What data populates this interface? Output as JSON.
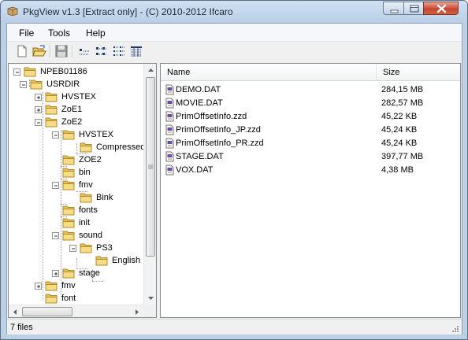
{
  "window": {
    "title": "PkgView v1.3 [Extract only] - (C) 2010-2012 Ifcaro"
  },
  "menu": [
    "File",
    "Tools",
    "Help"
  ],
  "toolbar": {
    "buttons": [
      "new-icon",
      "open-folder-icon",
      "save-icon",
      "large-icons-view-icon",
      "small-icons-view-icon",
      "list-view-icon",
      "details-view-icon"
    ]
  },
  "tree": {
    "nodes": [
      {
        "label": "NPEB01186"
      },
      {
        "label": "USRDIR"
      },
      {
        "label": "HVSTEX"
      },
      {
        "label": "ZoE1"
      },
      {
        "label": "ZoE2"
      },
      {
        "label": "HVSTEX"
      },
      {
        "label": "Compressed"
      },
      {
        "label": "ZOE2"
      },
      {
        "label": "bin"
      },
      {
        "label": "fmv"
      },
      {
        "label": "Bink"
      },
      {
        "label": "fonts"
      },
      {
        "label": "init"
      },
      {
        "label": "sound"
      },
      {
        "label": "PS3"
      },
      {
        "label": "English"
      },
      {
        "label": "stage"
      },
      {
        "label": "fmv"
      },
      {
        "label": "font"
      }
    ]
  },
  "list": {
    "columns": [
      "Name",
      "Size"
    ],
    "rows": [
      {
        "name": "DEMO.DAT",
        "size": "284,15 MB"
      },
      {
        "name": "MOVIE.DAT",
        "size": "282,57 MB"
      },
      {
        "name": "PrimOffsetInfo.zzd",
        "size": "45,22 KB"
      },
      {
        "name": "PrimOffsetInfo_JP.zzd",
        "size": "45,24 KB"
      },
      {
        "name": "PrimOffsetInfo_PR.zzd",
        "size": "45,24 KB"
      },
      {
        "name": "STAGE.DAT",
        "size": "397,77 MB"
      },
      {
        "name": "VOX.DAT",
        "size": "4,38 MB"
      }
    ]
  },
  "status": {
    "text": "7 files"
  }
}
